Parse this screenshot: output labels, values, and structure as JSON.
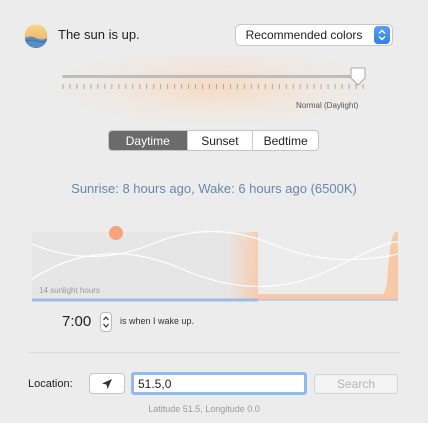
{
  "header": {
    "status_text": "The sun is up.",
    "color_mode": "Recommended colors"
  },
  "slider": {
    "caption": "Normal (Daylight)",
    "value_fraction": 0.98
  },
  "tabs": [
    {
      "label": "Daytime",
      "active": true
    },
    {
      "label": "Sunset",
      "active": false
    },
    {
      "label": "Bedtime",
      "active": false
    }
  ],
  "info_line": "Sunrise: 8 hours ago, Wake: 6 hours ago (6500K)",
  "graph": {
    "sunlight_label": "14 sunlight hours"
  },
  "wake": {
    "time": "7:00",
    "caption": "is when I wake up."
  },
  "location": {
    "label": "Location:",
    "input_value": "51.5,0",
    "search_label": "Search",
    "coordinates_caption": "Latitude 51.5, Longitude 0.0"
  },
  "colors": {
    "accent": "#2f7fe5",
    "info_text": "#6a86ac",
    "sun_dot": "#f6a47c",
    "night_band": "#f7c9a8"
  },
  "icons": {
    "status": "sun-over-water-icon",
    "locate": "location-arrow-icon",
    "dropdown": "chevron-updown-icon"
  }
}
